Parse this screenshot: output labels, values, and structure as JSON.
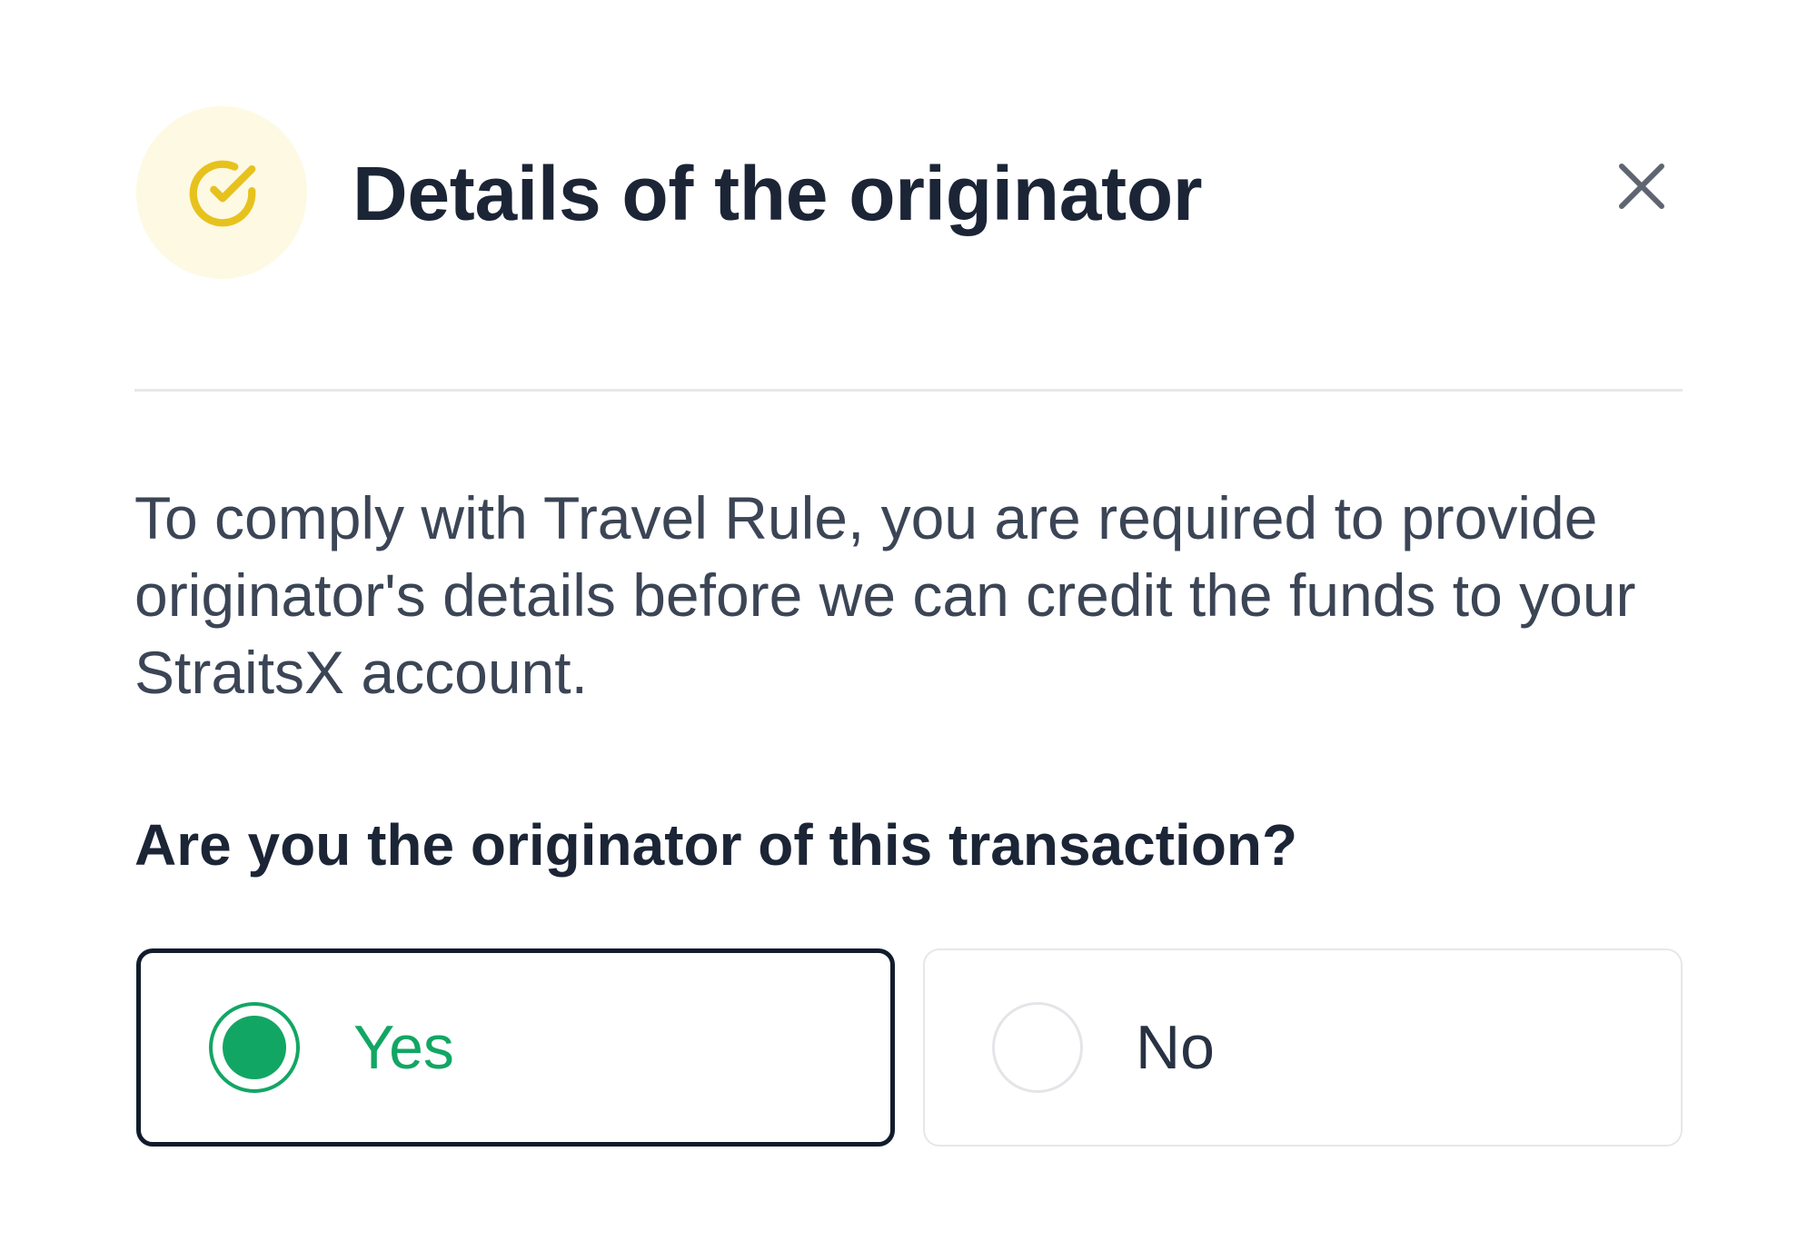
{
  "dialog": {
    "title": "Details of the originator",
    "description": "To comply with Travel Rule, you are required to provide originator's details before we can credit the funds to your StraitsX account.",
    "question": "Are you the originator of this transaction?",
    "options": [
      {
        "label": "Yes",
        "selected": true
      },
      {
        "label": "No",
        "selected": false
      }
    ],
    "icons": {
      "header": "check-circle-icon",
      "close": "close-icon"
    }
  },
  "colors": {
    "accent_yellow": "#e7c21d",
    "badge_background": "#fef9e3",
    "selected_green": "#12a664",
    "title_text": "#1b2536",
    "body_text": "#3b4555",
    "selected_border": "#111c2d",
    "divider": "#e6e8eb"
  }
}
